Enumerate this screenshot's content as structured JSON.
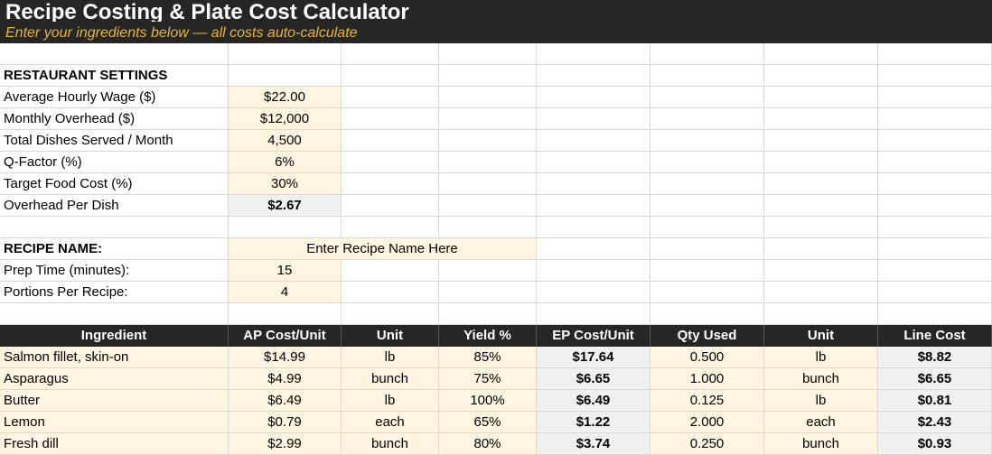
{
  "title": "Recipe Costing & Plate Cost Calculator",
  "subtitle": "Enter your ingredients below — all costs auto-calculate",
  "settings": {
    "header": "RESTAURANT SETTINGS",
    "rows": [
      {
        "label": "Average Hourly Wage ($)",
        "value": "$22.00"
      },
      {
        "label": "Monthly Overhead ($)",
        "value": "$12,000"
      },
      {
        "label": "Total Dishes Served / Month",
        "value": "4,500"
      },
      {
        "label": "Q-Factor (%)",
        "value": "6%"
      },
      {
        "label": "Target Food Cost (%)",
        "value": "30%"
      },
      {
        "label": "Overhead Per Dish",
        "value": "$2.67"
      }
    ]
  },
  "recipe": {
    "name_label": "RECIPE NAME:",
    "name_value": "Enter Recipe Name Here",
    "prep_label": "Prep Time (minutes):",
    "prep_value": "15",
    "portions_label": "Portions Per Recipe:",
    "portions_value": "4"
  },
  "table": {
    "headers": [
      "Ingredient",
      "AP Cost/Unit",
      "Unit",
      "Yield %",
      "EP Cost/Unit",
      "Qty Used",
      "Unit",
      "Line Cost"
    ],
    "rows": [
      [
        "Salmon fillet, skin-on",
        "$14.99",
        "lb",
        "85%",
        "$17.64",
        "0.500",
        "lb",
        "$8.82"
      ],
      [
        "Asparagus",
        "$4.99",
        "bunch",
        "75%",
        "$6.65",
        "1.000",
        "bunch",
        "$6.65"
      ],
      [
        "Butter",
        "$6.49",
        "lb",
        "100%",
        "$6.49",
        "0.125",
        "lb",
        "$0.81"
      ],
      [
        "Lemon",
        "$0.79",
        "each",
        "65%",
        "$1.22",
        "2.000",
        "each",
        "$2.43"
      ],
      [
        "Fresh dill",
        "$2.99",
        "bunch",
        "80%",
        "$3.74",
        "0.250",
        "bunch",
        "$0.93"
      ]
    ]
  },
  "colors": {
    "header_bg": "#262626",
    "subtitle": "#e5b53a",
    "input_fill": "#fff5e0",
    "calc_fill": "#f0f0f0"
  }
}
